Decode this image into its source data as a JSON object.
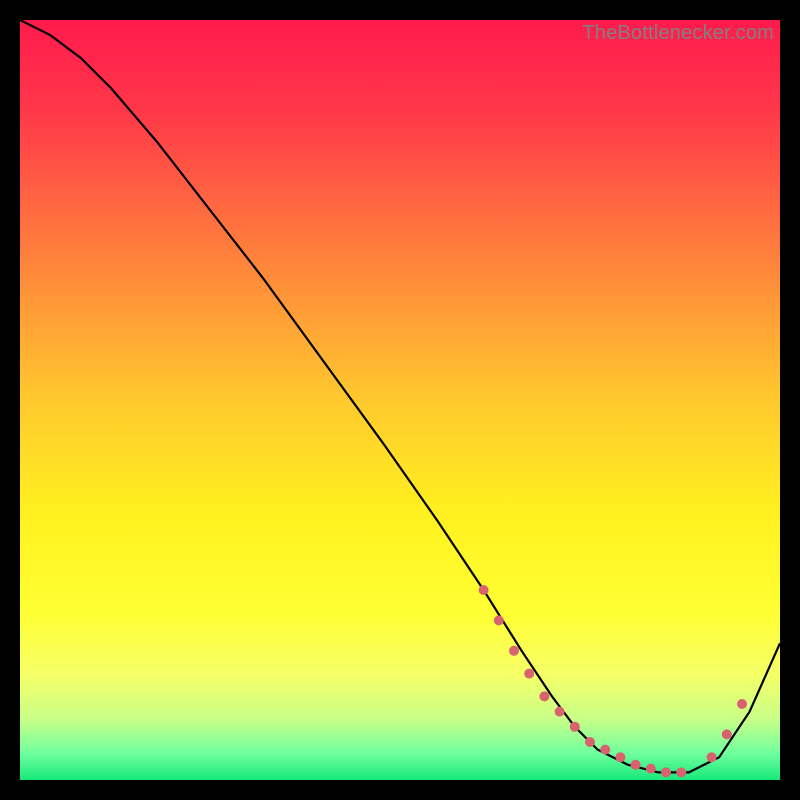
{
  "watermark": "TheBottlenecker.com",
  "gradient": {
    "stops": [
      {
        "offset": 0.0,
        "color": "#ff1a4d"
      },
      {
        "offset": 0.12,
        "color": "#ff3849"
      },
      {
        "offset": 0.3,
        "color": "#ff7d3d"
      },
      {
        "offset": 0.5,
        "color": "#ffc92e"
      },
      {
        "offset": 0.65,
        "color": "#fff11f"
      },
      {
        "offset": 0.78,
        "color": "#ffff33"
      },
      {
        "offset": 0.86,
        "color": "#f6ff66"
      },
      {
        "offset": 0.92,
        "color": "#c8ff88"
      },
      {
        "offset": 0.965,
        "color": "#6fff9e"
      },
      {
        "offset": 1.0,
        "color": "#17e97a"
      }
    ]
  },
  "chart_data": {
    "type": "line",
    "title": "",
    "xlabel": "",
    "ylabel": "",
    "xlim": [
      0,
      100
    ],
    "ylim": [
      0,
      100
    ],
    "series": [
      {
        "name": "curve",
        "x": [
          0,
          4,
          8,
          12,
          18,
          25,
          32,
          40,
          48,
          55,
          61,
          66,
          70,
          73,
          76,
          80,
          84,
          88,
          92,
          96,
          100
        ],
        "y": [
          100,
          98,
          95,
          91,
          84,
          75,
          66,
          55,
          44,
          34,
          25,
          17,
          11,
          7,
          4,
          2,
          1,
          1,
          3,
          9,
          18
        ]
      }
    ],
    "markers": {
      "name": "dots",
      "color": "#d9626f",
      "x": [
        61,
        63,
        65,
        67,
        69,
        71,
        73,
        75,
        77,
        79,
        81,
        83,
        85,
        87,
        91,
        93,
        95
      ],
      "y": [
        25,
        21,
        17,
        14,
        11,
        9,
        7,
        5,
        4,
        3,
        2,
        1.5,
        1,
        1,
        3,
        6,
        10
      ]
    }
  }
}
